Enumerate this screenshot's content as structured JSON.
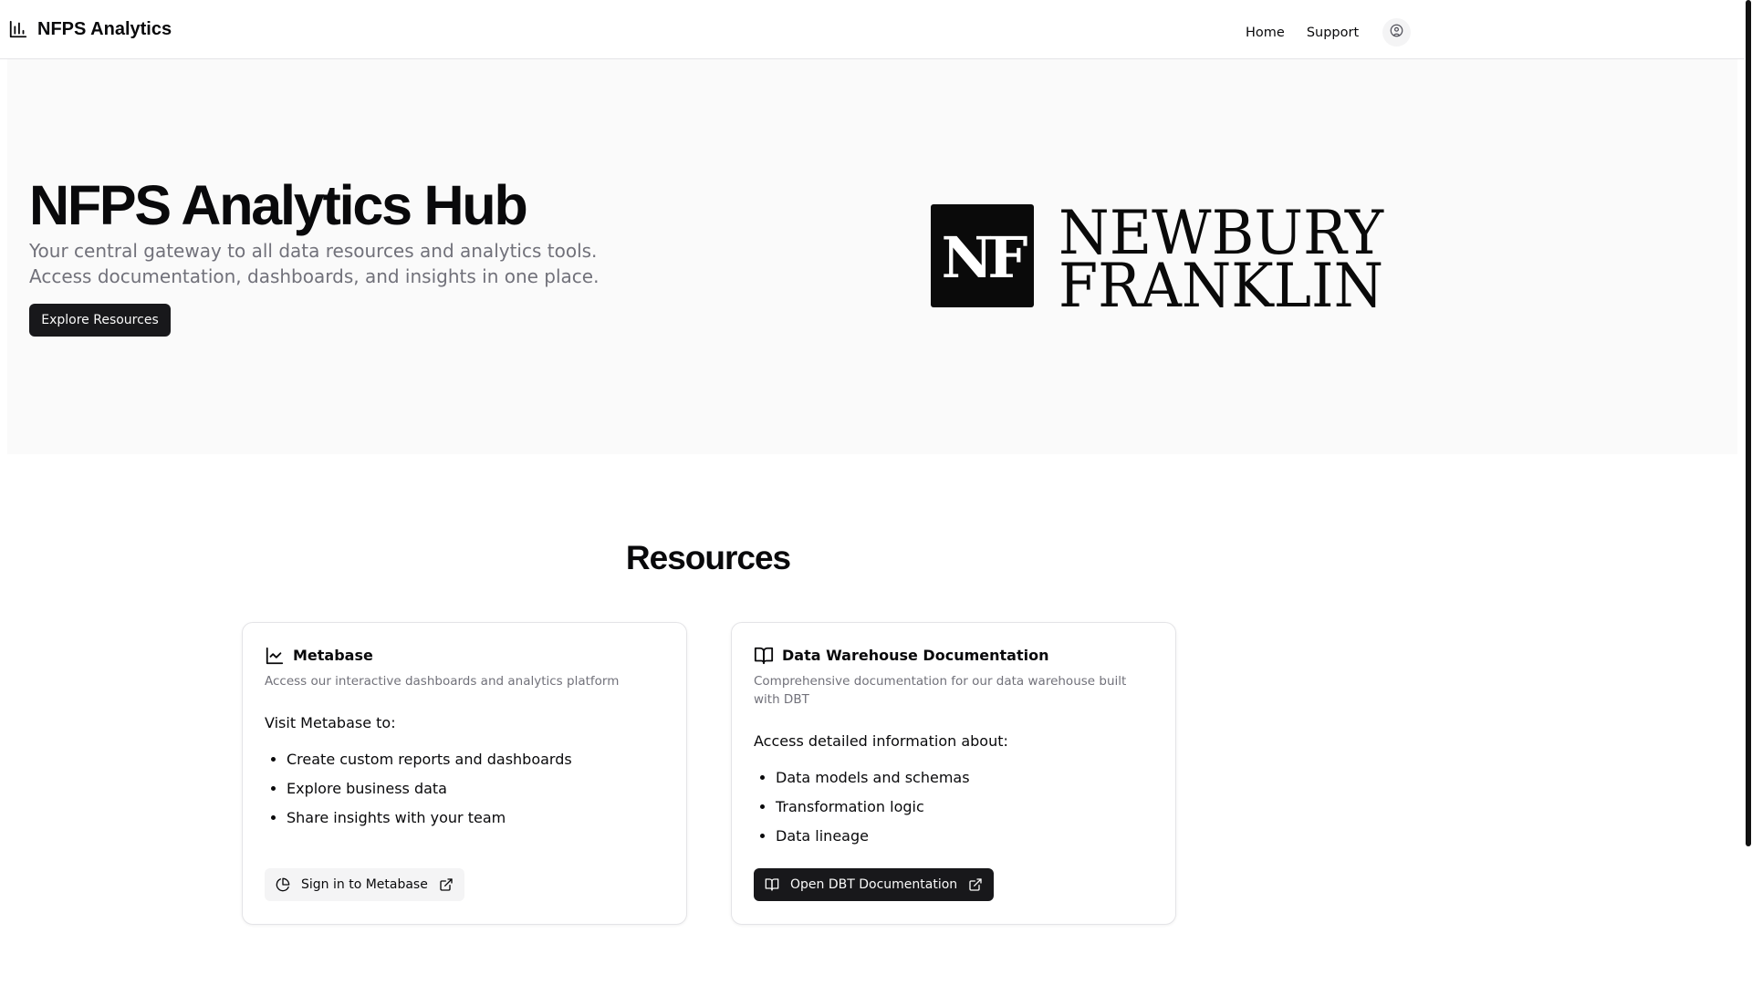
{
  "header": {
    "brand": "NFPS Analytics",
    "nav": {
      "home": "Home",
      "support": "Support"
    }
  },
  "hero": {
    "title": "NFPS Analytics Hub",
    "subtitle": "Your central gateway to all data resources and analytics tools. Access documentation, dashboards, and insights in one place.",
    "cta": "Explore Resources",
    "logo": {
      "monogram": "NF",
      "line1": "NEWBURY",
      "line2": "FRANKLIN"
    }
  },
  "resources": {
    "title": "Resources",
    "cards": [
      {
        "title": "Metabase",
        "description": "Access our interactive dashboards and analytics platform",
        "intro": "Visit Metabase to:",
        "items": [
          "Create custom reports and dashboards",
          "Explore business data",
          "Share insights with your team"
        ],
        "button": "Sign in to Metabase"
      },
      {
        "title": "Data Warehouse Documentation",
        "description": "Comprehensive documentation for our data warehouse built with DBT",
        "intro": "Access detailed information about:",
        "items": [
          "Data models and schemas",
          "Transformation logic",
          "Data lineage"
        ],
        "button": "Open DBT Documentation"
      }
    ]
  },
  "colors": {
    "primary": "#18181b",
    "muted_text": "#71717a",
    "hero_background": "#fafafa",
    "border": "#e4e4e7"
  },
  "icons": {
    "brand": "bar-chart-icon",
    "profile": "user-circle-icon",
    "metabase": "line-chart-icon",
    "dbt": "open-book-icon",
    "metabase_button": "pie-chart-icon",
    "external": "external-link-icon"
  }
}
